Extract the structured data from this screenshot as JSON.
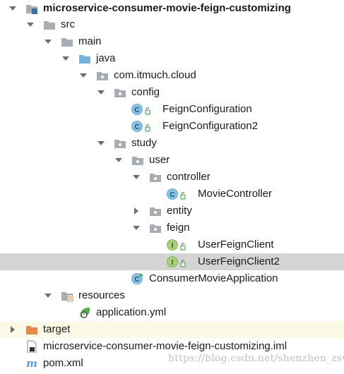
{
  "tree": {
    "rows": [
      {
        "label": "microservice-consumer-movie-feign-customizing",
        "icon": "module-folder-icon",
        "arrow": "chevron-down-icon",
        "bold": true
      },
      {
        "label": "src",
        "icon": "folder-icon",
        "arrow": "chevron-down-icon"
      },
      {
        "label": "main",
        "icon": "folder-icon",
        "arrow": "chevron-down-icon"
      },
      {
        "label": "java",
        "icon": "source-folder-icon",
        "arrow": "chevron-down-icon"
      },
      {
        "label": "com.itmuch.cloud",
        "icon": "package-icon",
        "arrow": "chevron-down-icon"
      },
      {
        "label": "config",
        "icon": "package-icon",
        "arrow": "chevron-down-icon"
      },
      {
        "label": "FeignConfiguration",
        "icon": "class-icon",
        "arrow": ""
      },
      {
        "label": "FeignConfiguration2",
        "icon": "class-icon",
        "arrow": ""
      },
      {
        "label": "study",
        "icon": "package-icon",
        "arrow": "chevron-down-icon"
      },
      {
        "label": "user",
        "icon": "package-icon",
        "arrow": "chevron-down-icon"
      },
      {
        "label": "controller",
        "icon": "package-icon",
        "arrow": "chevron-down-icon"
      },
      {
        "label": "MovieController",
        "icon": "class-icon",
        "arrow": ""
      },
      {
        "label": "entity",
        "icon": "package-icon",
        "arrow": "chevron-right-icon"
      },
      {
        "label": "feign",
        "icon": "package-icon",
        "arrow": "chevron-down-icon"
      },
      {
        "label": "UserFeignClient",
        "icon": "interface-icon",
        "arrow": ""
      },
      {
        "label": "UserFeignClient2",
        "icon": "interface-icon",
        "arrow": "",
        "selected": true
      },
      {
        "label": "ConsumerMovieApplication",
        "icon": "spring-boot-class-icon",
        "arrow": ""
      },
      {
        "label": "resources",
        "icon": "resources-folder-icon",
        "arrow": "chevron-down-icon"
      },
      {
        "label": "application.yml",
        "icon": "spring-yml-icon",
        "arrow": ""
      },
      {
        "label": "target",
        "icon": "excluded-folder-icon",
        "arrow": "chevron-right-icon",
        "highlight": true
      },
      {
        "label": "microservice-consumer-movie-feign-customizing.iml",
        "icon": "iml-file-icon",
        "arrow": ""
      },
      {
        "label": "pom.xml",
        "icon": "maven-icon",
        "arrow": ""
      }
    ],
    "icon_glyphs": {
      "class": "C",
      "interface": "I",
      "maven": "m"
    }
  },
  "watermark": "https://blog.csdn.net/shenzhen_zsw",
  "colors": {
    "selected_row": "#d4d4d4",
    "highlight_row": "#fcf9e6",
    "folder_gray": "#a7adb3",
    "source_folder_blue": "#76b3d9",
    "excluded_folder_orange": "#e8864a",
    "class_blue": "#86c3e6",
    "interface_green": "#a9cf7a",
    "lock_green": "#4ea85a"
  }
}
